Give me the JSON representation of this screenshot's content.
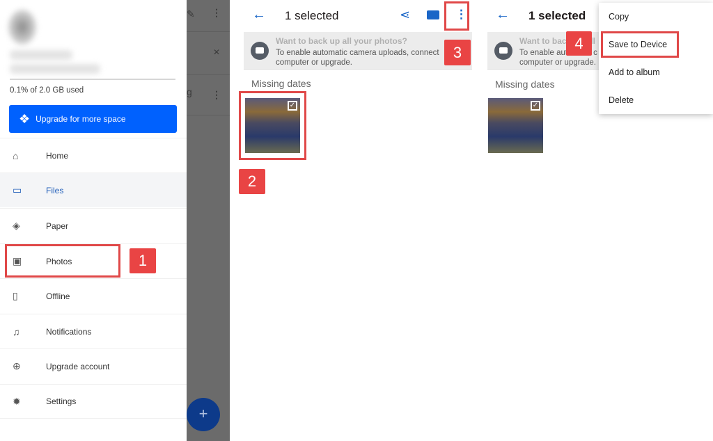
{
  "panel1": {
    "storage_text": "0.1% of 2.0 GB used",
    "upgrade_button": "Upgrade for more space",
    "nav": [
      {
        "label": "Home",
        "icon": "home-icon"
      },
      {
        "label": "Files",
        "icon": "folder-icon",
        "active": true
      },
      {
        "label": "Paper",
        "icon": "paper-layers-icon"
      },
      {
        "label": "Photos",
        "icon": "photo-icon"
      },
      {
        "label": "Offline",
        "icon": "offline-device-icon"
      },
      {
        "label": "Notifications",
        "icon": "bell-icon"
      },
      {
        "label": "Upgrade account",
        "icon": "upgrade-arrow-icon"
      },
      {
        "label": "Settings",
        "icon": "gear-icon"
      }
    ],
    "background_partial_text": "g",
    "fab_label": "+"
  },
  "panel2": {
    "title": "1 selected",
    "banner_heading": "Want to back up all your photos?",
    "banner_text_line1": "To enable automatic camera uploads, connect",
    "banner_text_line2": "computer or upgrade.",
    "section": "Missing dates"
  },
  "panel3": {
    "title": "1 selected",
    "banner_heading": "Want to back up all",
    "banner_text_line1": "To enable automatic c",
    "banner_text_line2": "computer or upgrade.",
    "section": "Missing dates",
    "menu": [
      "Copy",
      "Save to Device",
      "Add to album",
      "Delete"
    ]
  },
  "callouts": [
    "1",
    "2",
    "3",
    "4"
  ],
  "colors": {
    "accent": "#0061fe",
    "callout": "#e94444",
    "active_nav": "#1c5bb8"
  }
}
